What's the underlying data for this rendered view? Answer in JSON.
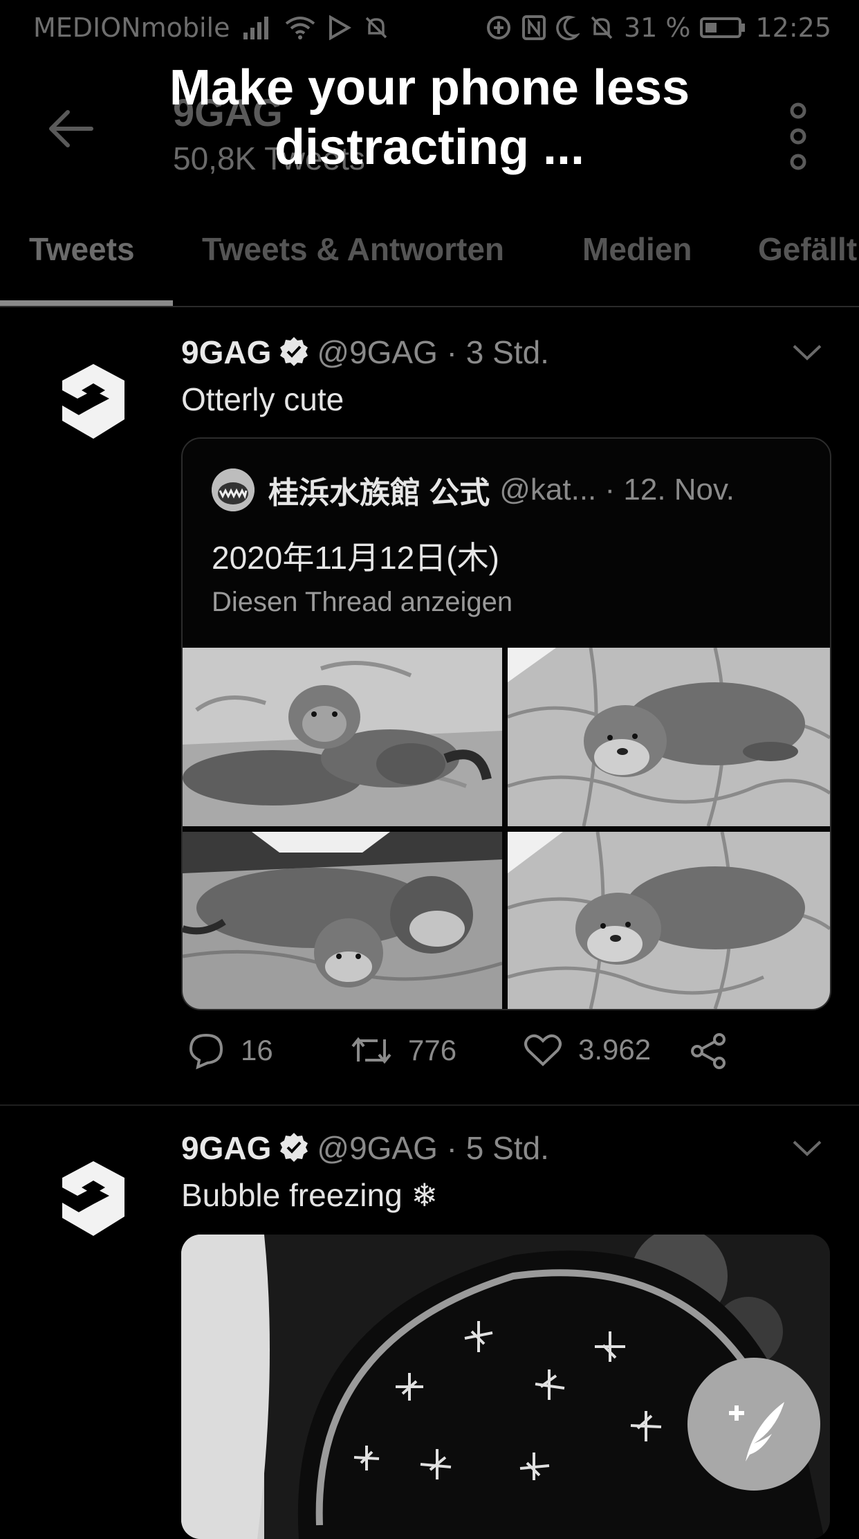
{
  "status_bar": {
    "carrier": "MEDIONmobile",
    "battery": "31 %",
    "time": "12:25"
  },
  "header": {
    "title": "9GAG",
    "subtitle": "50,8K Tweets"
  },
  "overlay": {
    "line1": "Make your phone less",
    "line2": "distracting ..."
  },
  "tabs": [
    {
      "label": "Tweets"
    },
    {
      "label": "Tweets & Antworten"
    },
    {
      "label": "Medien"
    },
    {
      "label": "Gefällt mir"
    }
  ],
  "tweets": [
    {
      "name": "9GAG",
      "handle": "@9GAG · 3 Std.",
      "text": "Otterly cute",
      "quote": {
        "name": "桂浜水族館 公式",
        "handle": "@kat... · 12. Nov.",
        "text": "2020年11月12日(木)",
        "thread_link": "Diesen Thread anzeigen"
      },
      "replies": "16",
      "retweets": "776",
      "likes": "3.962"
    },
    {
      "name": "9GAG",
      "handle": "@9GAG · 5 Std.",
      "text": "Bubble freezing ❄"
    }
  ],
  "icons": {
    "back": "arrow-left-icon",
    "more": "more-vertical-icon",
    "verified": "verified-badge-icon",
    "reply": "reply-icon",
    "retweet": "retweet-icon",
    "like": "heart-icon",
    "share": "share-icon",
    "compose": "compose-tweet-icon"
  }
}
